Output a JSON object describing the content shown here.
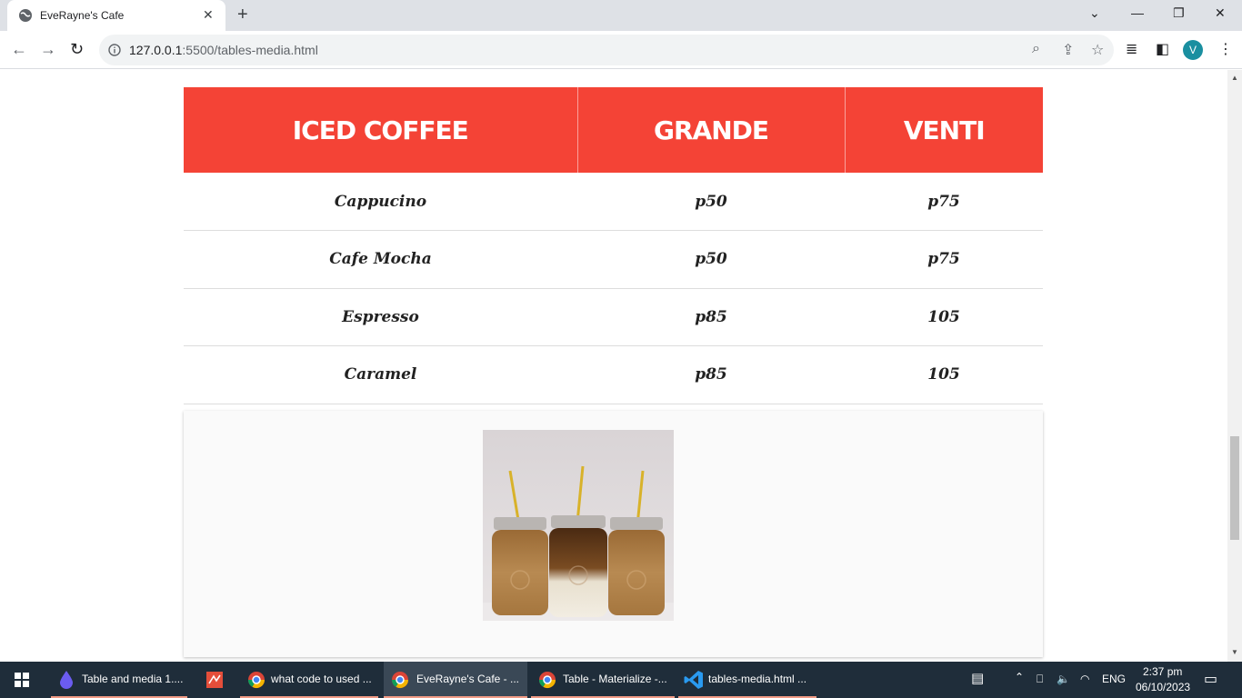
{
  "browser": {
    "tab_title": "EveRayne's Cafe",
    "url_host": "127.0.0.1",
    "url_rest": ":5500/tables-media.html",
    "profile_initial": "V"
  },
  "table": {
    "headers": [
      "ICED COFFEE",
      "GRANDE",
      "VENTI"
    ],
    "rows": [
      [
        "Cappucino",
        "p50",
        "p75"
      ],
      [
        "Cafe Mocha",
        "p50",
        "p75"
      ],
      [
        "Espresso",
        "p85",
        "105"
      ],
      [
        "Caramel",
        "p85",
        "105"
      ]
    ]
  },
  "media": {
    "image_alt": "three iced coffee jars with straws"
  },
  "taskbar": {
    "items": [
      {
        "label": "Table and media 1...."
      },
      {
        "label": ""
      },
      {
        "label": "what code to used ..."
      },
      {
        "label": "EveRayne's Cafe - ..."
      },
      {
        "label": "Table - Materialize -..."
      },
      {
        "label": "tables-media.html ..."
      }
    ],
    "lang": "ENG",
    "time": "2:37 pm",
    "date": "06/10/2023"
  },
  "colors": {
    "header_red": "#f44336",
    "taskbar": "#1f2d3a"
  }
}
